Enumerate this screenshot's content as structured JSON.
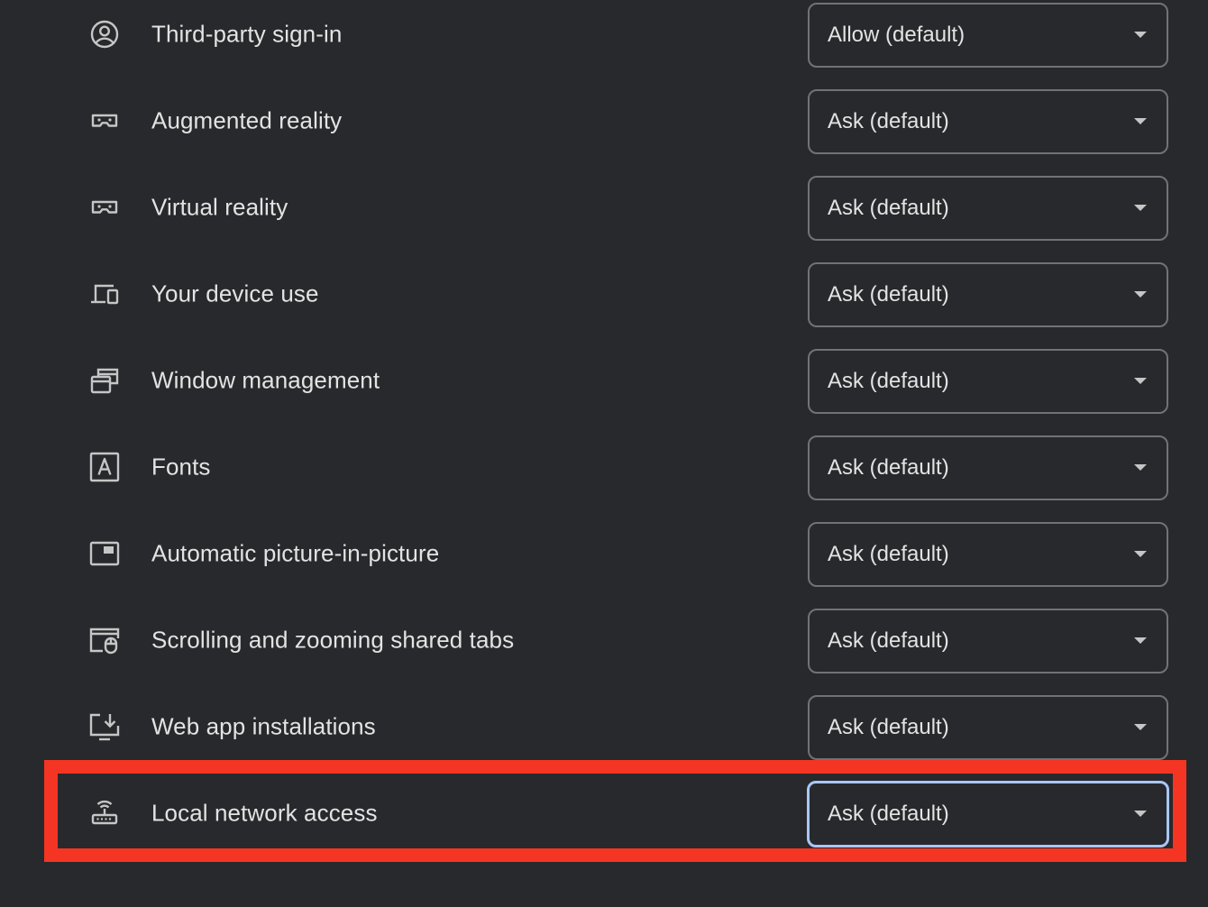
{
  "settings": [
    {
      "label": "Third-party sign-in",
      "value": "Allow (default)",
      "icon": "account-circle-icon"
    },
    {
      "label": "Augmented reality",
      "value": "Ask (default)",
      "icon": "vr-headset-icon"
    },
    {
      "label": "Virtual reality",
      "value": "Ask (default)",
      "icon": "vr-headset-icon"
    },
    {
      "label": "Your device use",
      "value": "Ask (default)",
      "icon": "devices-icon"
    },
    {
      "label": "Window management",
      "value": "Ask (default)",
      "icon": "windows-icon"
    },
    {
      "label": "Fonts",
      "value": "Ask (default)",
      "icon": "font-icon"
    },
    {
      "label": "Automatic picture-in-picture",
      "value": "Ask (default)",
      "icon": "picture-in-picture-icon"
    },
    {
      "label": "Scrolling and zooming shared tabs",
      "value": "Ask (default)",
      "icon": "tab-mouse-icon"
    },
    {
      "label": "Web app installations",
      "value": "Ask (default)",
      "icon": "install-desktop-icon"
    },
    {
      "label": "Local network access",
      "value": "Ask (default)",
      "icon": "router-icon"
    }
  ],
  "colors": {
    "background": "#28292c",
    "text": "#e3e3e3",
    "select_border": "#6f7378",
    "focus_ring": "#a8c7fa",
    "highlight": "#f43524"
  }
}
